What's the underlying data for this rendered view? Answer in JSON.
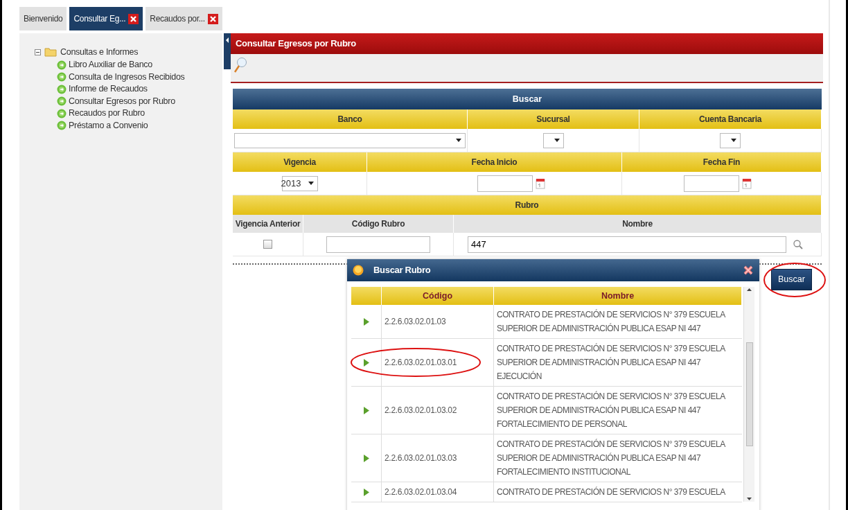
{
  "tabs": [
    {
      "label": "Bienvenido",
      "selected": false,
      "closable": false
    },
    {
      "label": "Consultar Eg...",
      "selected": true,
      "closable": true
    },
    {
      "label": "Recaudos por...",
      "selected": false,
      "closable": true
    }
  ],
  "tree": {
    "label": "Consultas e Informes",
    "expanded": true,
    "children": [
      {
        "label": "Libro Auxiliar de Banco"
      },
      {
        "label": "Consulta de Ingresos Recibidos"
      },
      {
        "label": "Informe de Recaudos"
      },
      {
        "label": "Consultar Egresos por Rubro"
      },
      {
        "label": "Recaudos por Rubro"
      },
      {
        "label": "Préstamo a Convenio"
      }
    ]
  },
  "panel": {
    "title": "Consultar Egresos por Rubro",
    "search_form": {
      "title": "Buscar",
      "groups": [
        {
          "fields": [
            {
              "label": "Banco",
              "kind": "select"
            },
            {
              "label": "Sucursal",
              "kind": "select"
            },
            {
              "label": "Cuenta Bancaria",
              "kind": "select"
            }
          ]
        },
        {
          "fields": [
            {
              "label": "Vigencia",
              "kind": "select",
              "value": "2013"
            },
            {
              "label": "Fecha Inicio",
              "kind": "date"
            },
            {
              "label": "Fecha Fin",
              "kind": "date"
            }
          ]
        },
        {
          "title": "Rubro",
          "fields": [
            {
              "label": "Vigencia Anterior",
              "kind": "checkbox",
              "checked": false
            },
            {
              "label": "Código Rubro",
              "kind": "text"
            },
            {
              "label": "Nombre",
              "kind": "search",
              "value": "447"
            }
          ]
        }
      ]
    },
    "button": {
      "label": "Buscar",
      "circled": true
    }
  },
  "dialog": {
    "title": "Buscar Rubro",
    "columns": [
      "Código",
      "Nombre"
    ],
    "rows": [
      {
        "code": "2.2.6.03.02.01.03",
        "name": "CONTRATO DE PRESTACIÓN DE SERVICIOS N° 379 ESCUELA SUPERIOR DE ADMINISTRACIÓN PUBLICA ESAP NI 447",
        "circled": false
      },
      {
        "code": "2.2.6.03.02.01.03.01",
        "name": "CONTRATO DE PRESTACIÓN DE SERVICIOS N° 379 ESCUELA SUPERIOR DE ADMINISTRACIÓN PUBLICA ESAP NI 447 EJECUCIÓN",
        "circled": true
      },
      {
        "code": "2.2.6.03.02.01.03.02",
        "name": "CONTRATO DE PRESTACIÓN DE SERVICIOS N° 379 ESCUELA SUPERIOR DE ADMINISTRACIÓN PUBLICA ESAP NI 447 FORTALECIMIENTO DE PERSONAL",
        "circled": false
      },
      {
        "code": "2.2.6.03.02.01.03.03",
        "name": "CONTRATO DE PRESTACIÓN DE SERVICIOS N° 379 ESCUELA SUPERIOR DE ADMINISTRACIÓN PUBLICA ESAP NI 447 FORTALECIMIENTO INSTITUCIONAL",
        "circled": false
      },
      {
        "code": "2.2.6.03.02.01.03.04",
        "name": "CONTRATO DE PRESTACIÓN DE SERVICIOS N° 379 ESCUELA",
        "circled": false
      }
    ]
  }
}
